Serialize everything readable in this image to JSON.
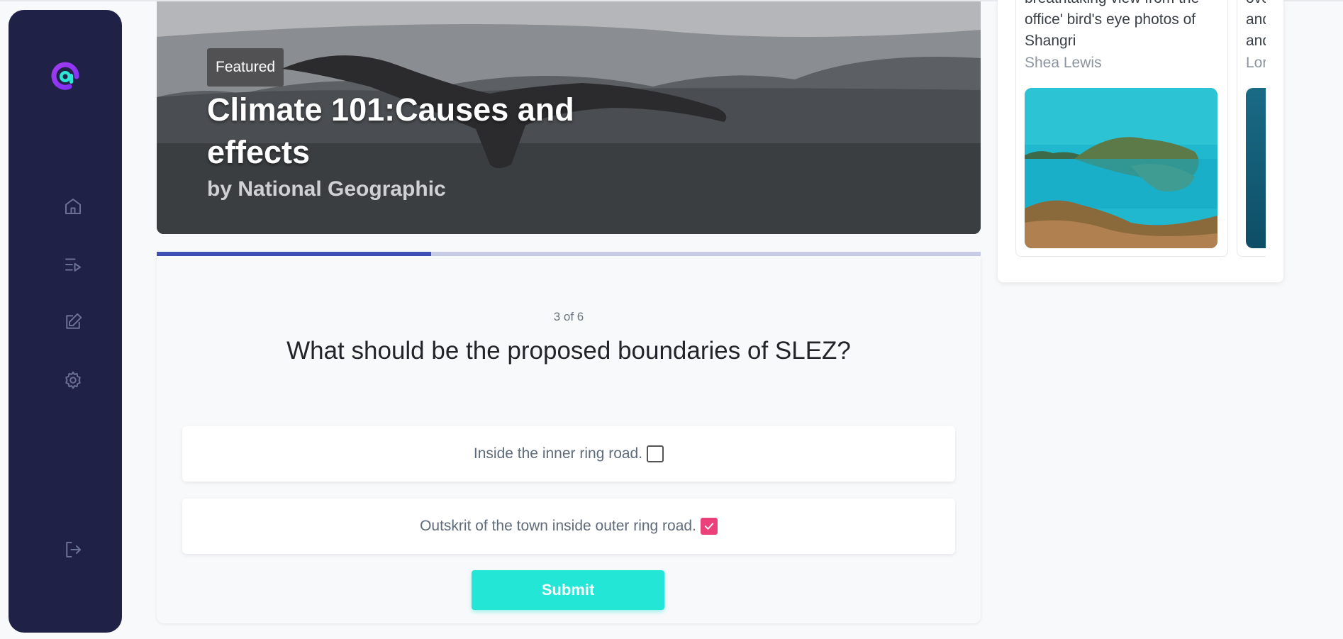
{
  "sidebar": {
    "nav": [
      {
        "icon": "home-icon"
      },
      {
        "icon": "playlist-icon"
      },
      {
        "icon": "edit-icon"
      },
      {
        "icon": "settings-icon"
      }
    ],
    "logout_icon": "logout-icon"
  },
  "hero": {
    "badge": "Featured",
    "title": "Climate 101:Causes and effects",
    "subtitle": "by National Geographic"
  },
  "quiz": {
    "progress": 0.333,
    "counter": "3 of 6",
    "question": "What should be the proposed boundaries of SLEZ?",
    "options": [
      {
        "label": "Inside the inner ring road.",
        "checked": false
      },
      {
        "label": "Outskrit of the town inside outer ring road.",
        "checked": true
      }
    ],
    "submit_label": "Submit"
  },
  "articles": [
    {
      "text_lines": [
        "breathtaking  view from the",
        "office' bird's eye photos of",
        "Shangri"
      ],
      "author": "Shea Lewis"
    },
    {
      "text_lines": [
        "ove",
        "and",
        "and"
      ],
      "author": "Lor"
    }
  ],
  "colors": {
    "sidebar": "#1f2246",
    "accent": "#3f51b5",
    "submit": "#23e6d6",
    "checkbox_checked": "#ec407a"
  }
}
